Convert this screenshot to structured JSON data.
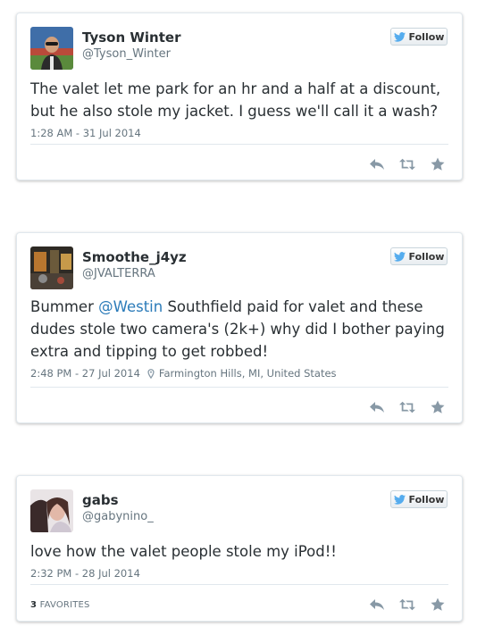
{
  "follow_label": "Follow",
  "tweets": [
    {
      "name": "Tyson Winter",
      "handle": "@Tyson_Winter",
      "text": "The valet let me park for an hr and a half at a discount, but he also stole my jacket. I guess we'll call it a wash?",
      "timestamp": "1:28 AM - 31 Jul 2014",
      "avatar_icon": "profile-photo-man-sunglasses"
    },
    {
      "name": "Smoothe_j4yz",
      "handle": "@JVALTERRA",
      "text_before": "Bummer ",
      "mention": "@Westin",
      "text_after": " Southfield paid for valet and these dudes stole two camera's (2k+) why did I bother paying extra and tipping to get robbed!",
      "timestamp": "2:48 PM - 27 Jul 2014",
      "location": "Farmington Hills, MI, United States",
      "avatar_icon": "profile-photo-street-scene"
    },
    {
      "name": "gabs",
      "handle": "@gabynino_",
      "text": "love how the valet people stole my iPod!!",
      "timestamp": "2:32 PM - 28 Jul 2014",
      "favorites_count": "3",
      "favorites_label": "FAVORITES",
      "avatar_icon": "profile-photo-woman"
    }
  ],
  "colors": {
    "mention": "#2b7bb9",
    "twitter_blue": "#55acee",
    "action_gray": "#8899a6"
  }
}
